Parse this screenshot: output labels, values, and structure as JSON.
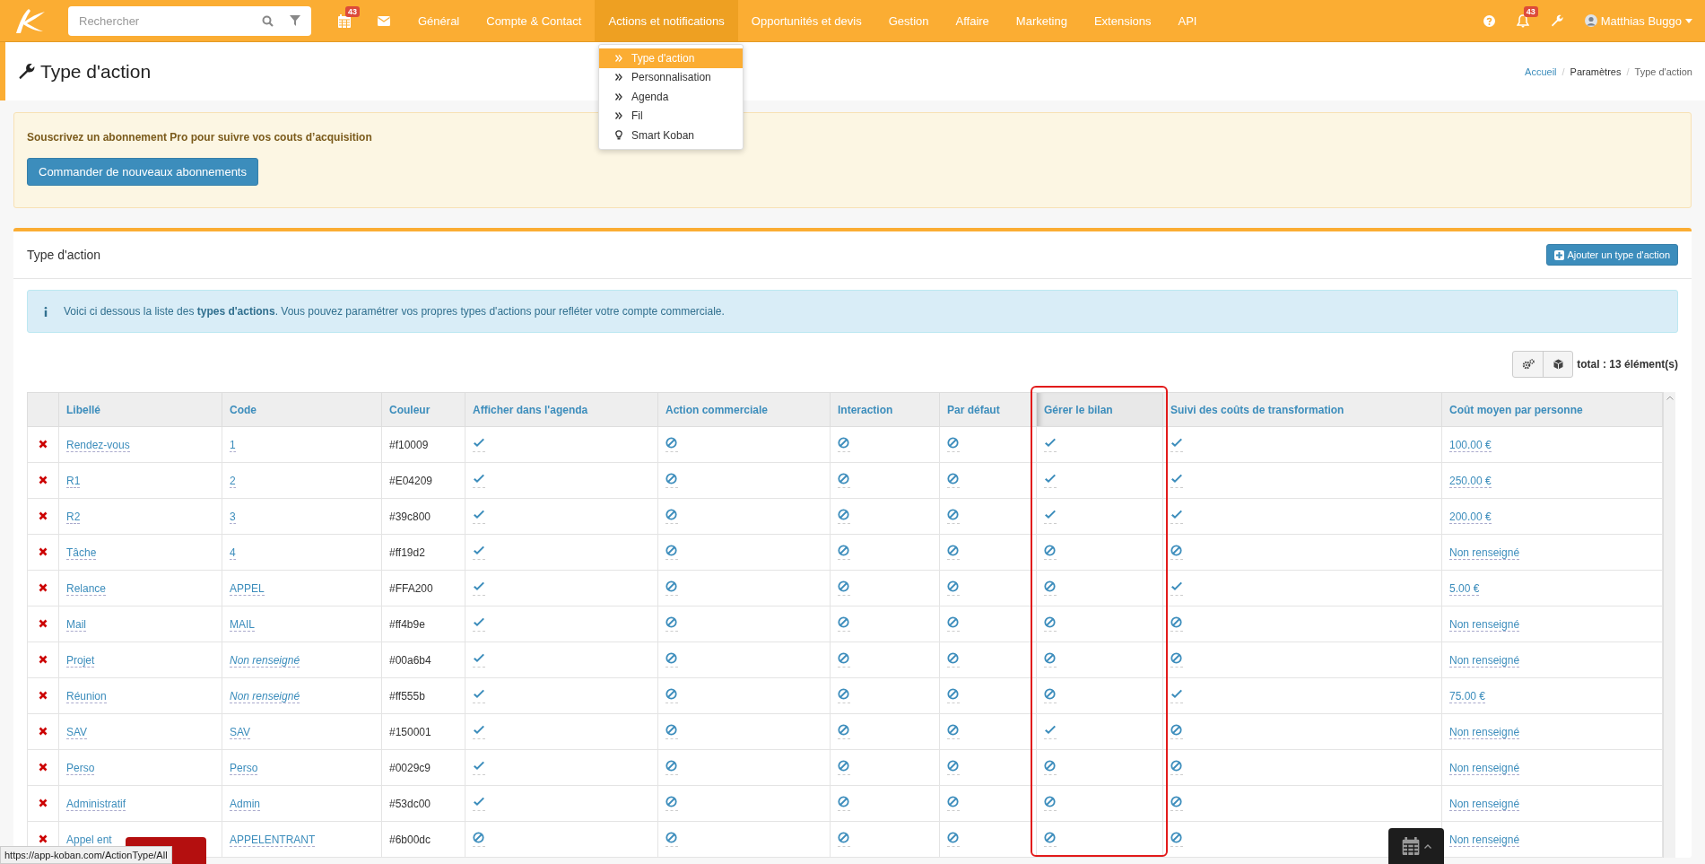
{
  "topbar": {
    "search": {
      "placeholder": "Rechercher"
    },
    "calendar_badge": "43",
    "nav": [
      {
        "label": "Général",
        "selected": false
      },
      {
        "label": "Compte & Contact",
        "selected": false
      },
      {
        "label": "Actions et notifications",
        "selected": true
      },
      {
        "label": "Opportunités et devis",
        "selected": false
      },
      {
        "label": "Gestion",
        "selected": false
      },
      {
        "label": "Affaire",
        "selected": false
      },
      {
        "label": "Marketing",
        "selected": false
      },
      {
        "label": "Extensions",
        "selected": false
      },
      {
        "label": "API",
        "selected": false
      }
    ],
    "notification_badge": "43",
    "user": "Matthias Buggo"
  },
  "dropdown": [
    {
      "label": "Type d'action",
      "kind": "chevron",
      "selected": true
    },
    {
      "label": "Personnalisation",
      "kind": "chevron",
      "selected": false
    },
    {
      "label": "Agenda",
      "kind": "chevron",
      "selected": false
    },
    {
      "label": "Fil",
      "kind": "chevron",
      "selected": false
    },
    {
      "label": "Smart Koban",
      "kind": "bulb",
      "selected": false
    }
  ],
  "page": {
    "title": "Type d'action",
    "breadcrumbs": [
      {
        "label": "Accueil",
        "kind": "link"
      },
      {
        "label": "/",
        "kind": "separator"
      },
      {
        "label": "Paramètres",
        "kind": "item"
      },
      {
        "label": "/",
        "kind": "separator"
      },
      {
        "label": "Type d'action",
        "kind": "current"
      }
    ]
  },
  "alert": {
    "text": "Souscrivez un abonnement Pro pour suivre vos couts d’acquisition",
    "button": "Commander de nouveaux abonnements"
  },
  "panel": {
    "title": "Type d'action",
    "add_button": "Ajouter un type d'action",
    "info": "Voici ci dessous la liste des **types d'actions**. Vous pouvez paramétrer vos propres types d'actions pour refléter votre compte commerciale.",
    "total": "total : 13 élément(s)"
  },
  "table": {
    "columns": [
      {
        "label": "Libellé",
        "highlighted": false
      },
      {
        "label": "Code",
        "highlighted": false
      },
      {
        "label": "Couleur",
        "highlighted": false
      },
      {
        "label": "Afficher dans l'agenda",
        "highlighted": false
      },
      {
        "label": "Action commerciale",
        "highlighted": false
      },
      {
        "label": "Interaction",
        "highlighted": false
      },
      {
        "label": "Par défaut",
        "highlighted": false
      },
      {
        "label": "Gérer le bilan",
        "highlighted": true
      },
      {
        "label": "Suivi des coûts de transformation",
        "highlighted": false
      },
      {
        "label": "Coût moyen par personne",
        "highlighted": false
      }
    ],
    "rows": [
      {
        "label": "Rendez-vous",
        "code": "1",
        "code_missing": false,
        "couleur": "#f10009",
        "flags": [
          true,
          false,
          false,
          false,
          true,
          true
        ],
        "cost": "100.00 €"
      },
      {
        "label": "R1",
        "code": "2",
        "code_missing": false,
        "couleur": "#E04209",
        "flags": [
          true,
          false,
          false,
          false,
          true,
          true
        ],
        "cost": "250.00 €"
      },
      {
        "label": "R2",
        "code": "3",
        "code_missing": false,
        "couleur": "#39c800",
        "flags": [
          true,
          false,
          false,
          false,
          true,
          true
        ],
        "cost": "200.00 €"
      },
      {
        "label": "Tâche",
        "code": "4",
        "code_missing": false,
        "couleur": "#ff19d2",
        "flags": [
          true,
          false,
          false,
          false,
          false,
          false
        ],
        "cost": "Non renseigné"
      },
      {
        "label": "Relance",
        "code": "APPEL",
        "code_missing": false,
        "couleur": "#FFA200",
        "flags": [
          true,
          false,
          false,
          false,
          false,
          true
        ],
        "cost": "5.00 €"
      },
      {
        "label": "Mail",
        "code": "MAIL",
        "code_missing": false,
        "couleur": "#ff4b9e",
        "flags": [
          true,
          false,
          false,
          false,
          false,
          false
        ],
        "cost": "Non renseigné"
      },
      {
        "label": "Projet",
        "code": "Non renseigné",
        "code_missing": true,
        "couleur": "#00a6b4",
        "flags": [
          true,
          false,
          false,
          false,
          false,
          false
        ],
        "cost": "Non renseigné"
      },
      {
        "label": "Réunion",
        "code": "Non renseigné",
        "code_missing": true,
        "couleur": "#ff555b",
        "flags": [
          true,
          false,
          false,
          false,
          false,
          true
        ],
        "cost": "75.00 €"
      },
      {
        "label": "SAV",
        "code": "SAV",
        "code_missing": false,
        "couleur": "#150001",
        "flags": [
          true,
          false,
          false,
          false,
          true,
          false
        ],
        "cost": "Non renseigné"
      },
      {
        "label": "Perso",
        "code": "Perso",
        "code_missing": false,
        "couleur": "#0029c9",
        "flags": [
          true,
          false,
          false,
          false,
          false,
          false
        ],
        "cost": "Non renseigné"
      },
      {
        "label": "Administratif",
        "code": "Admin",
        "code_missing": false,
        "couleur": "#53dc00",
        "flags": [
          true,
          false,
          false,
          false,
          false,
          false
        ],
        "cost": "Non renseigné"
      },
      {
        "label": "Appel ent",
        "code": "APPELENTRANT",
        "code_missing": false,
        "couleur": "#6b00dc",
        "flags": [
          false,
          false,
          false,
          false,
          false,
          false
        ],
        "cost": "Non renseigné"
      }
    ]
  },
  "status_url": "https://app-koban.com/ActionType/All"
}
